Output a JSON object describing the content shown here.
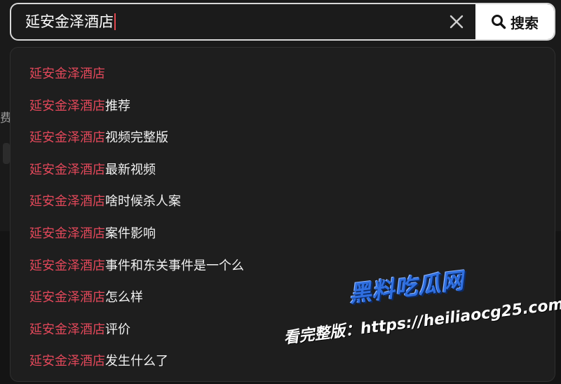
{
  "search": {
    "query": "延安金泽酒店",
    "button_label": "搜索"
  },
  "background": {
    "fragment_text": "费"
  },
  "suggestions": [
    {
      "match": "延安金泽酒店",
      "rest": ""
    },
    {
      "match": "延安金泽酒店",
      "rest": "推荐"
    },
    {
      "match": "延安金泽酒店",
      "rest": "视频完整版"
    },
    {
      "match": "延安金泽酒店",
      "rest": "最新视频"
    },
    {
      "match": "延安金泽酒店",
      "rest": "啥时候杀人案"
    },
    {
      "match": "延安金泽酒店",
      "rest": "案件影响"
    },
    {
      "match": "延安金泽酒店",
      "rest": "事件和东关事件是一个么"
    },
    {
      "match": "延安金泽酒店",
      "rest": "怎么样"
    },
    {
      "match": "延安金泽酒店",
      "rest": "评价"
    },
    {
      "match": "延安金泽酒店",
      "rest": "发生什么了"
    }
  ],
  "watermark": {
    "logo_text": "黑料吃瓜网",
    "url_text": "看完整版：https://heiliaocg25.com"
  },
  "colors": {
    "match_highlight": "#e2485a",
    "accent_caret": "#e2484f",
    "dropdown_bg": "#1e1e1e",
    "button_bg": "#ffffff"
  },
  "icons": {
    "clear": "close-icon",
    "search": "search-icon"
  }
}
